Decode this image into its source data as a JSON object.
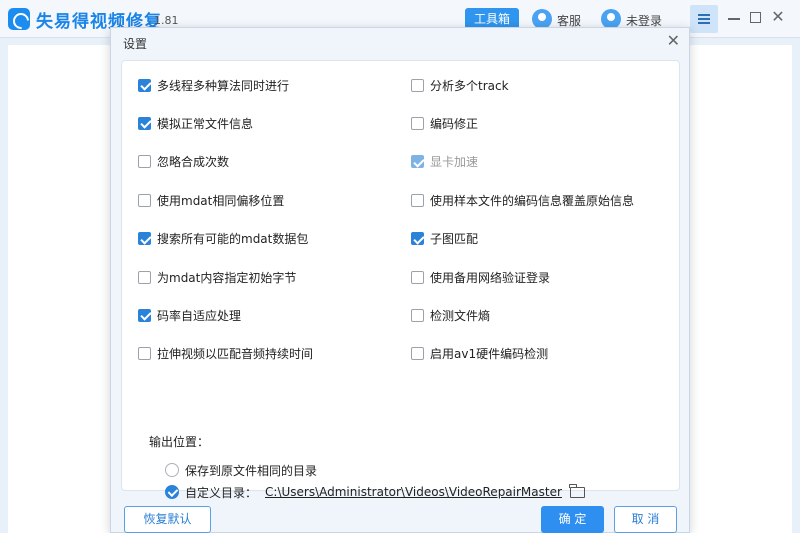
{
  "app": {
    "name": "失易得视频修复",
    "version": "1.81",
    "toolbox_label": "工具箱",
    "service_label": "客服",
    "login_label": "未登录"
  },
  "dialog": {
    "title": "设置",
    "close_glyph": "✕",
    "options": [
      {
        "label": "多线程多种算法同时进行",
        "checked": true,
        "enabled": true
      },
      {
        "label": "分析多个track",
        "checked": false,
        "enabled": true
      },
      {
        "label": "模拟正常文件信息",
        "checked": true,
        "enabled": true
      },
      {
        "label": "编码修正",
        "checked": false,
        "enabled": true
      },
      {
        "label": "忽略合成次数",
        "checked": false,
        "enabled": true
      },
      {
        "label": "显卡加速",
        "checked": true,
        "enabled": false
      },
      {
        "label": "使用mdat相同偏移位置",
        "checked": false,
        "enabled": true
      },
      {
        "label": "使用样本文件的编码信息覆盖原始信息",
        "checked": false,
        "enabled": true
      },
      {
        "label": "搜索所有可能的mdat数据包",
        "checked": true,
        "enabled": true
      },
      {
        "label": "子图匹配",
        "checked": true,
        "enabled": true
      },
      {
        "label": "为mdat内容指定初始字节",
        "checked": false,
        "enabled": true
      },
      {
        "label": "使用备用网络验证登录",
        "checked": false,
        "enabled": true
      },
      {
        "label": "码率自适应处理",
        "checked": true,
        "enabled": true
      },
      {
        "label": "检测文件熵",
        "checked": false,
        "enabled": true
      },
      {
        "label": "拉伸视频以匹配音频持续时间",
        "checked": false,
        "enabled": true
      },
      {
        "label": "启用av1硬件编码检测",
        "checked": false,
        "enabled": true
      }
    ],
    "output": {
      "title": "输出位置：",
      "same_dir_label": "保存到原文件相同的目录",
      "same_dir_selected": false,
      "custom_dir_label": "自定义目录：",
      "custom_dir_selected": true,
      "custom_path": "C:\\Users\\Administrator\\Videos\\VideoRepairMaster"
    },
    "buttons": {
      "reset": "恢复默认",
      "ok": "确 定",
      "cancel": "取 消"
    }
  },
  "colors": {
    "accent": "#2e8ff0",
    "checkbox_checked": "#2a83d9",
    "checkbox_disabled": "#7fb3e5"
  }
}
